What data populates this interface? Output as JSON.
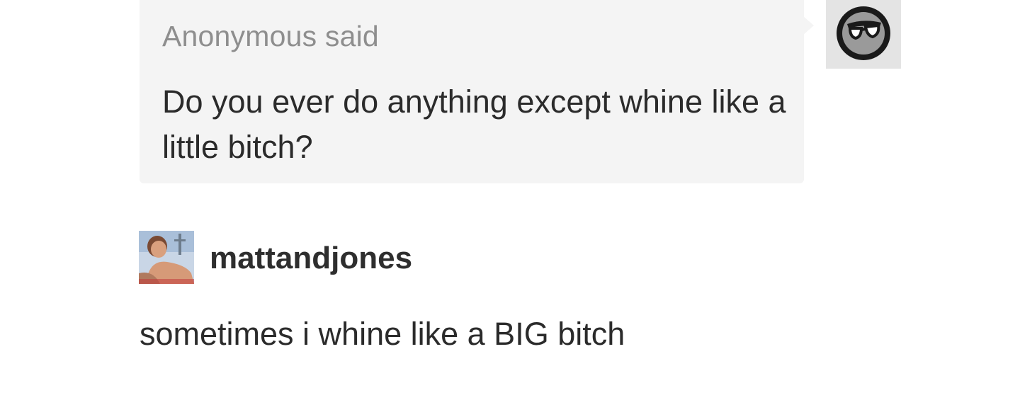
{
  "ask": {
    "asker_label": "Anonymous said",
    "question": "Do you ever do anything except whine like a little bitch?",
    "asker_avatar_icon": "anonymous-sunglasses-icon"
  },
  "answer": {
    "username": "mattandjones",
    "text": "sometimes i whine like a BIG bitch"
  },
  "colors": {
    "bubble_bg": "#f4f4f4",
    "label_gray": "#8e8e8e",
    "text_dark": "#2b2b2b"
  }
}
